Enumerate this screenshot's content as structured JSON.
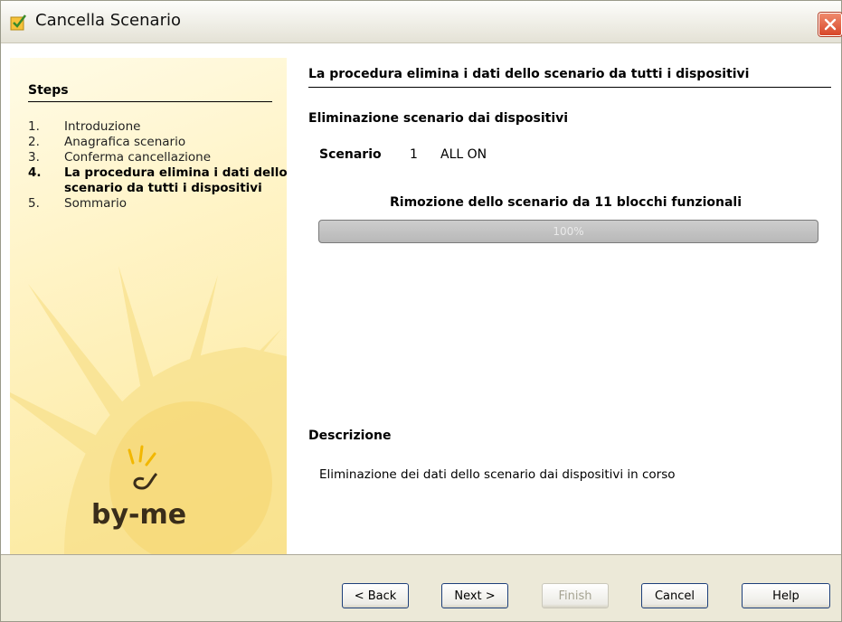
{
  "window": {
    "title": "Cancella Scenario"
  },
  "sidebar": {
    "steps_title": "Steps",
    "steps": [
      {
        "num": "1.",
        "label": "Introduzione",
        "active": false
      },
      {
        "num": "2.",
        "label": "Anagrafica scenario",
        "active": false
      },
      {
        "num": "3.",
        "label": "Conferma cancellazione",
        "active": false
      },
      {
        "num": "4.",
        "label": "La procedura elimina i dati dello scenario da tutti i dispositivi",
        "active": true
      },
      {
        "num": "5.",
        "label": "Sommario",
        "active": false
      }
    ],
    "logo_text": "by-me"
  },
  "main": {
    "heading": "La procedura elimina i dati dello scenario da tutti i dispositivi",
    "subheading": "Eliminazione scenario dai dispositivi",
    "scenario": {
      "label": "Scenario",
      "id": "1",
      "name": "ALL ON"
    },
    "progress": {
      "title": "Rimozione dello scenario da 11 blocchi funzionali",
      "value_text": "100%",
      "value": 1.0
    },
    "description": {
      "title": "Descrizione",
      "text": "Eliminazione dei dati dello scenario dai dispositivi in corso"
    }
  },
  "buttons": {
    "back": "< Back",
    "next": "Next >",
    "finish": "Finish",
    "cancel": "Cancel",
    "help": "Help"
  },
  "colors": {
    "sidebar_bg": "#fff3c4",
    "close_button": "#d8472a",
    "button_border": "#1d3f7a"
  }
}
